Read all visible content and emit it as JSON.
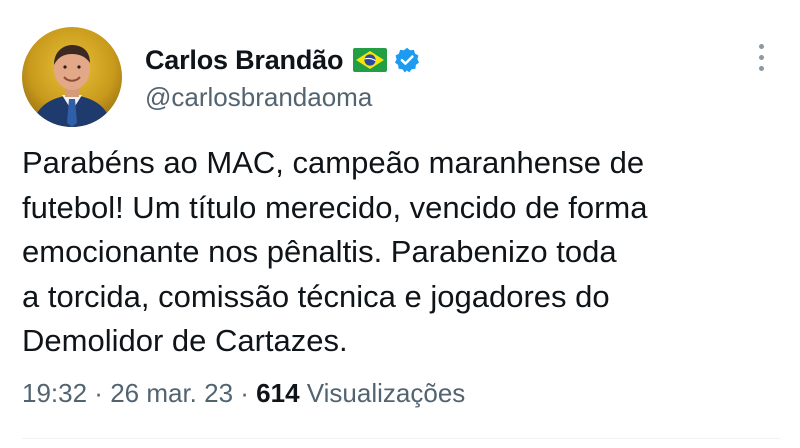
{
  "author": {
    "display_name": "Carlos Brandão",
    "handle": "@carlosbrandaoma",
    "flag_icon": "brazil-flag-icon",
    "verified_icon": "verified-badge-icon",
    "verified_color": "#1d9bf0"
  },
  "menu": {
    "icon": "more-vertical-icon"
  },
  "tweet": {
    "text_lines": [
      "Parabéns ao MAC, campeão maranhense de",
      "futebol! Um título merecido, vencido de forma",
      "emocionante nos pênaltis. Parabenizo toda",
      "a torcida, comissão técnica e jogadores do",
      "Demolidor de Cartazes."
    ]
  },
  "meta": {
    "time": "19:32",
    "separator": " · ",
    "date": "26 mar. 23",
    "views_count": "614",
    "views_label": "Visualizações"
  },
  "colors": {
    "text_primary": "#0f1419",
    "text_secondary": "#536471",
    "background": "#ffffff"
  }
}
